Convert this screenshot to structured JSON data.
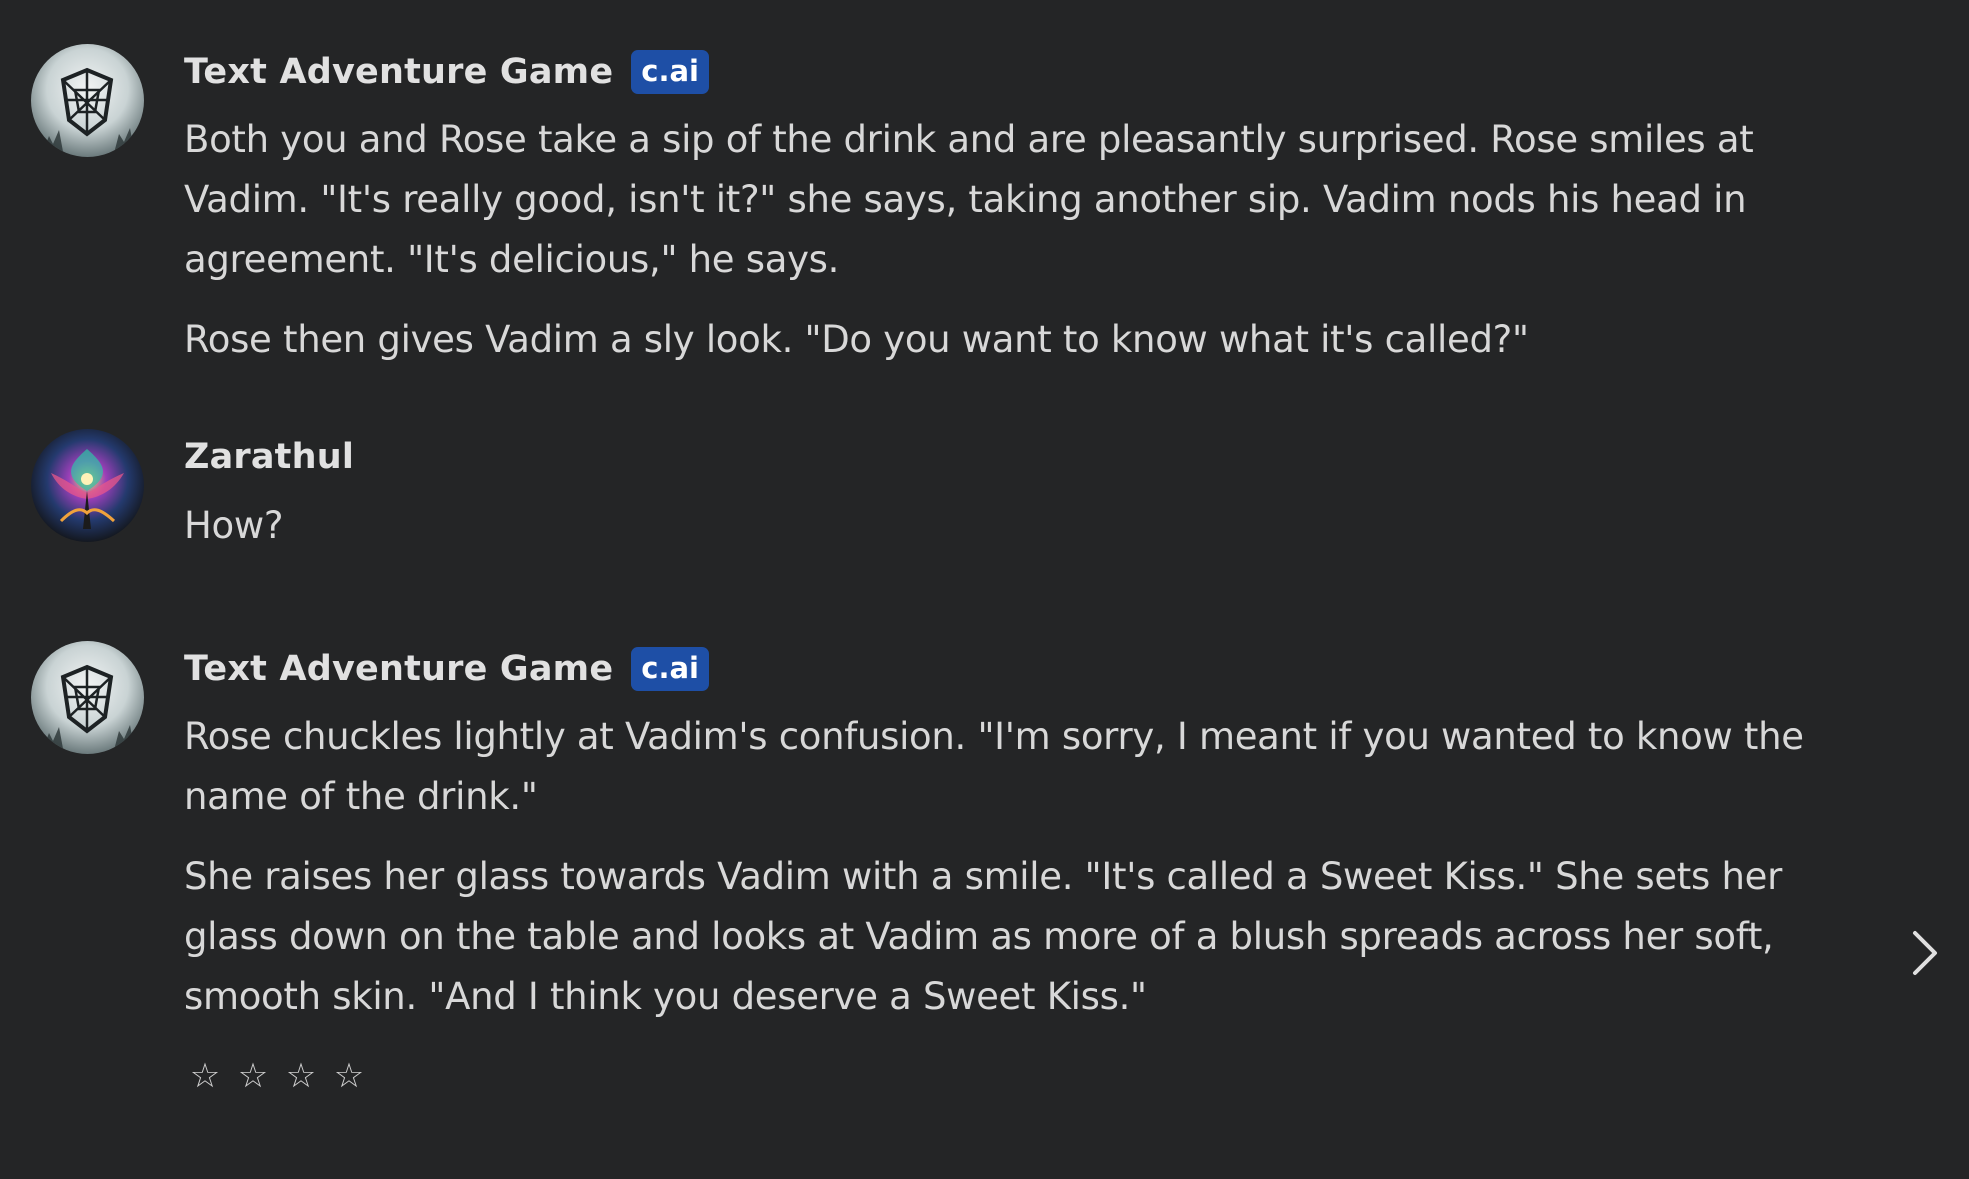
{
  "messages": [
    {
      "author": "Text Adventure Game",
      "badge": "c.ai",
      "paragraphs": [
        "Both you and Rose take a sip of the drink and are pleasantly surprised. Rose smiles at Vadim. \"It's really good, isn't it?\" she says, taking another sip. Vadim nods his head in agreement. \"It's delicious,\" he says.",
        "Rose then gives Vadim a sly look. \"Do you want to know what it's called?\""
      ]
    },
    {
      "author": "Zarathul",
      "paragraphs": [
        "How?"
      ]
    },
    {
      "author": "Text Adventure Game",
      "badge": "c.ai",
      "paragraphs": [
        "Rose chuckles lightly at Vadim's confusion. \"I'm sorry, I meant if you wanted to know the name of the drink.\"",
        "She raises her glass towards Vadim with a smile. \"It's called a Sweet Kiss.\" She sets her glass down on the table and looks at Vadim as more of a blush spreads across her soft, smooth skin. \"And I think you deserve a Sweet Kiss.\""
      ]
    }
  ],
  "rating": {
    "stars": [
      "☆",
      "☆",
      "☆",
      "☆"
    ],
    "value": 0,
    "max": 4
  },
  "icons": {
    "bot_avatar": "shield-web-avatar-icon",
    "user_avatar": "psychedelic-tree-avatar-icon",
    "next": "chevron-right-icon"
  },
  "colors": {
    "background": "#242526",
    "badge": "#1e4fa6",
    "text": "#d8d8d8"
  }
}
